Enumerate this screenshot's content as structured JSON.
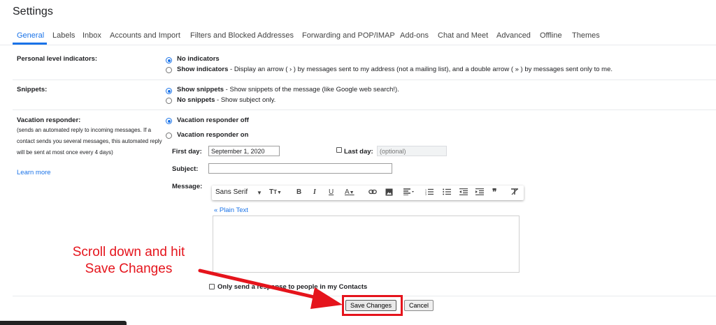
{
  "page": {
    "title": "Settings"
  },
  "tabs": [
    {
      "label": "General",
      "active": true
    },
    {
      "label": "Labels"
    },
    {
      "label": "Inbox"
    },
    {
      "label": "Accounts and Import"
    },
    {
      "label": "Filters and Blocked Addresses"
    },
    {
      "label": "Forwarding and POP/IMAP"
    },
    {
      "label": "Add-ons"
    },
    {
      "label": "Chat and Meet"
    },
    {
      "label": "Advanced"
    },
    {
      "label": "Offline"
    },
    {
      "label": "Themes"
    }
  ],
  "personal_level": {
    "label": "Personal level indicators:",
    "opt1": "No indicators",
    "opt2_bold": "Show indicators",
    "opt2_desc": " - Display an arrow ( › ) by messages sent to my address (not a mailing list), and a double arrow ( » ) by messages sent only to me."
  },
  "snippets": {
    "label": "Snippets:",
    "opt1_bold": "Show snippets",
    "opt1_desc": " - Show snippets of the message (like Google web search!).",
    "opt2_bold": "No snippets",
    "opt2_desc": " - Show subject only."
  },
  "vacation": {
    "label": "Vacation responder:",
    "desc": "(sends an automated reply to incoming messages. If a contact sends you several messages, this automated reply will be sent at most once every 4 days)",
    "learn_more": "Learn more",
    "off": "Vacation responder off",
    "on": "Vacation responder on",
    "first_day_label": "First day:",
    "first_day_value": "September 1, 2020",
    "last_day_label": "Last day:",
    "last_day_placeholder": "(optional)",
    "subject_label": "Subject:",
    "message_label": "Message:",
    "font_name": "Sans Serif",
    "plain_text": "« Plain Text",
    "contacts_only": "Only send a response to people in my Contacts"
  },
  "actions": {
    "save": "Save Changes",
    "cancel": "Cancel"
  },
  "annotation": {
    "line1": "Scroll down and hit",
    "line2": "Save Changes"
  },
  "colors": {
    "accent": "#1a73e8",
    "annotation": "#e5141c"
  }
}
